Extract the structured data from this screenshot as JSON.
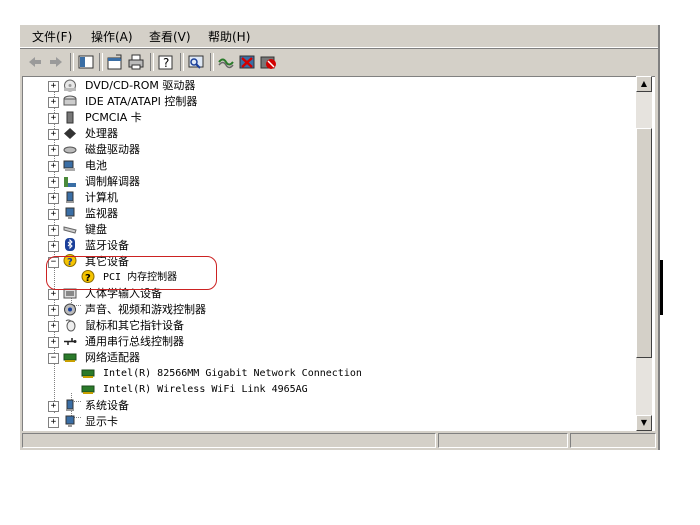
{
  "menu": [
    "文件(F)",
    "操作(A)",
    "查看(V)",
    "帮助(H)"
  ],
  "toolbar_icons": [
    "back-icon",
    "forward-icon",
    "show-hide-tree-icon",
    "properties-icon",
    "print-icon",
    "help-icon",
    "scan-hardware-icon",
    "update-driver-icon",
    "uninstall-icon",
    "disable-icon"
  ],
  "tree": {
    "items": [
      {
        "label": "DVD/CD-ROM 驱动器",
        "icon": "cdrom-icon"
      },
      {
        "label": "IDE ATA/ATAPI 控制器",
        "icon": "ide-controller-icon"
      },
      {
        "label": "PCMCIA 卡",
        "icon": "pcmcia-icon"
      },
      {
        "label": "处理器",
        "icon": "processor-icon"
      },
      {
        "label": "磁盘驱动器",
        "icon": "disk-drive-icon"
      },
      {
        "label": "电池",
        "icon": "battery-icon"
      },
      {
        "label": "调制解调器",
        "icon": "modem-icon"
      },
      {
        "label": "计算机",
        "icon": "computer-icon"
      },
      {
        "label": "监视器",
        "icon": "monitor-icon"
      },
      {
        "label": "键盘",
        "icon": "keyboard-icon"
      },
      {
        "label": "蓝牙设备",
        "icon": "bluetooth-icon"
      },
      {
        "label": "其它设备",
        "icon": "unknown-device-icon"
      },
      {
        "label": "PCI 内存控制器",
        "icon": "warning-device-icon"
      },
      {
        "label": "人体学输入设备",
        "icon": "hid-icon"
      },
      {
        "label": "声音、视频和游戏控制器",
        "icon": "sound-icon"
      },
      {
        "label": "鼠标和其它指针设备",
        "icon": "mouse-icon"
      },
      {
        "label": "通用串行总线控制器",
        "icon": "usb-icon"
      },
      {
        "label": "网络适配器",
        "icon": "network-adapter-icon"
      },
      {
        "label": "Intel(R) 82566MM Gigabit Network Connection",
        "icon": "network-card-icon"
      },
      {
        "label": "Intel(R) Wireless WiFi Link 4965AG",
        "icon": "network-card-icon"
      },
      {
        "label": "系统设备",
        "icon": "system-device-icon"
      },
      {
        "label": "显示卡",
        "icon": "display-adapter-icon"
      }
    ]
  },
  "colors": {
    "window": "#d4d0c8",
    "highlight": "#cc2222",
    "warning": "#f5c400"
  }
}
